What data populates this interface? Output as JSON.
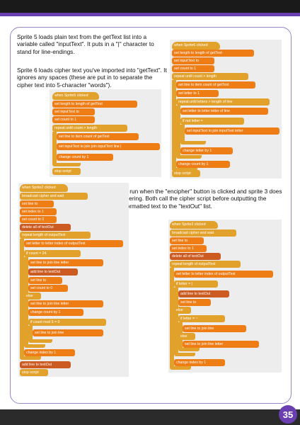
{
  "page": {
    "paragraph_1": "Sprite 5 loads plain text from the getText list into a variable called \"inputText\". It puts in a \"|\" character to stand for line-endings.",
    "paragraph_2": "Sprite 6 loads cipher text you've imported into \"getText\". It ignores any spaces (these are put in to separate the cipher text into 5-character \"words\").",
    "paragraph_3": "Sprite 2 is run when the \"encipher\" button is clicked and sprite 3 does the deciphering. Both call the cipher script before outputting the properly formatted text to the \"textOut\" list.",
    "page_number": "35"
  },
  "colors": {
    "control": "#e2a12a",
    "variables": "#ee7d16",
    "lists": "#cc5b22",
    "operators": "#5cb712",
    "accent_purple": "#6a3fb1"
  },
  "scripts": {
    "sprite5": [
      "when Sprite5 clicked",
      "set length to length of getText",
      "set inputText to",
      "set count to 1",
      "repeat until count > length",
      "set line to item count of getText",
      "set inputText to join join inputText line |",
      "change count by 1",
      "stop script"
    ],
    "sprite6": [
      "when Sprite6 clicked",
      "set length to length of getText",
      "set inputText to",
      "set count to 1",
      "repeat until count > length",
      "set line to item count of getText",
      "set letter to 1",
      "repeat until letters > length of line",
      "set letter to letter letter of line",
      "if not letter = ",
      "set inputText to join inputText letter",
      "change letter by 1",
      "change count by 1",
      "stop script"
    ],
    "sprite2": [
      "when Sprite2 clicked",
      "broadcast cipher and wait",
      "set line to",
      "set index to 1",
      "set count to 0",
      "delete all of textOut",
      "repeat length of outputText",
      "set letter to letter index of outputText",
      "if count = 24",
      "set line to join line letter",
      "add line to textOut",
      "set line to",
      "set count to 0",
      "else",
      "set line to join line letter",
      "change count by 1",
      "if count mod 5 = 0",
      "set line to join line",
      "change index by 1",
      "add line to textOut",
      "stop script"
    ],
    "sprite3": [
      "when Sprite3 clicked",
      "broadcast cipher and wait",
      "set line to",
      "set index to 1",
      "delete all of textOut",
      "repeat length of outputText",
      "set letter to letter index of outputText",
      "if letter = |",
      "add line to textOut",
      "set line to",
      "else",
      "if letter = ~",
      "set line to join line",
      "else",
      "set line to join line letter",
      "change index by 1"
    ]
  }
}
